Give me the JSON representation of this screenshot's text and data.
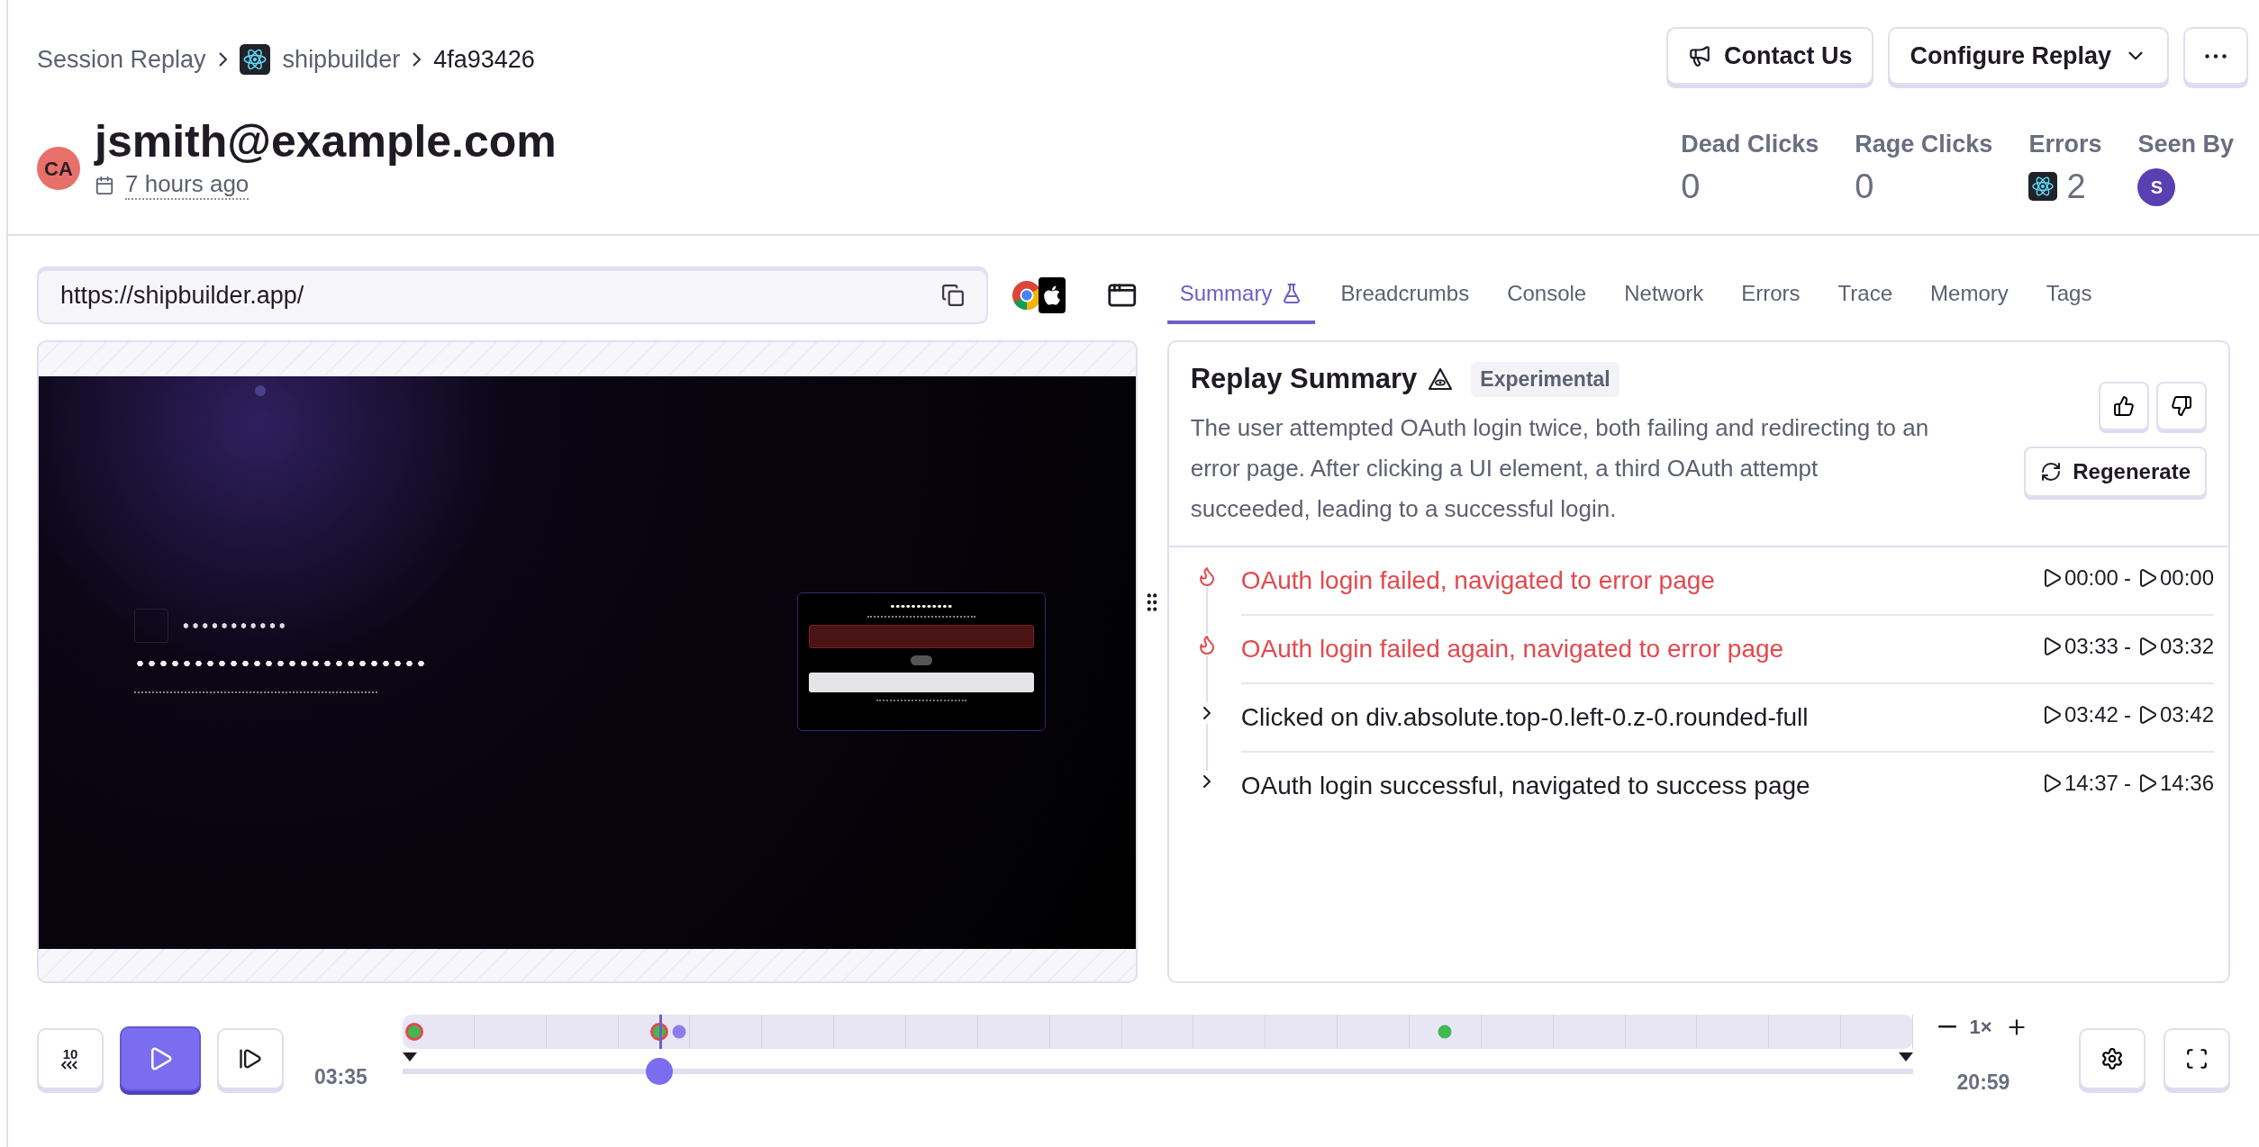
{
  "breadcrumbs": [
    {
      "label": "Session Replay",
      "kind": "link"
    },
    {
      "label": "shipbuilder",
      "kind": "project"
    },
    {
      "label": "4fa93426",
      "kind": "current"
    }
  ],
  "header_buttons": [
    {
      "label": "Contact Us",
      "kind": "contact"
    },
    {
      "label": "Configure Replay",
      "kind": "dropdown"
    },
    {
      "kind": "more"
    }
  ],
  "user": {
    "initials": "CA",
    "email": "jsmith@example.com",
    "time": "7 hours ago"
  },
  "stats": [
    {
      "label": "Dead Clicks",
      "value": "0",
      "kind": "count"
    },
    {
      "label": "Rage Clicks",
      "value": "0",
      "kind": "count"
    },
    {
      "label": "Errors",
      "value": "2",
      "kind": "errors"
    },
    {
      "label": "Seen By",
      "value": "S",
      "kind": "avatar"
    }
  ],
  "url": "https://shipbuilder.app/",
  "tabs": [
    {
      "label": "Summary",
      "selected": true,
      "kind": "experimental"
    },
    {
      "label": "Breadcrumbs",
      "selected": false,
      "kind": "plain"
    },
    {
      "label": "Console",
      "selected": false,
      "kind": "plain"
    },
    {
      "label": "Network",
      "selected": false,
      "kind": "plain"
    },
    {
      "label": "Errors",
      "selected": false,
      "kind": "plain"
    },
    {
      "label": "Trace",
      "selected": false,
      "kind": "plain"
    },
    {
      "label": "Memory",
      "selected": false,
      "kind": "plain"
    },
    {
      "label": "Tags",
      "selected": false,
      "kind": "plain"
    }
  ],
  "summary": {
    "title": "Replay Summary",
    "badge": "Experimental",
    "text": "The user attempted OAuth login twice, both failing and redirecting to an error page. After clicking a UI element, a third OAuth attempt succeeded, leading to a successful login.",
    "regenerate": "Regenerate",
    "items": [
      {
        "kind": "error",
        "text": "OAuth login failed, navigated to error page",
        "start": "00:00",
        "separator": "-",
        "end": "00:00"
      },
      {
        "kind": "error",
        "text": "OAuth login failed again, navigated to error page",
        "start": "03:33",
        "separator": "-",
        "end": "03:32"
      },
      {
        "kind": "expandable",
        "text": "Clicked on div.absolute.top-0.left-0.z-0.rounded-full",
        "start": "03:42",
        "separator": "-",
        "end": "03:42"
      },
      {
        "kind": "expandable",
        "text": "OAuth login successful, navigated to success page",
        "start": "14:37",
        "separator": "-",
        "end": "14:36"
      }
    ]
  },
  "player": {
    "rewind": "10",
    "current": "03:35",
    "duration": "20:59",
    "speed": "1×",
    "level": 0.17
  }
}
